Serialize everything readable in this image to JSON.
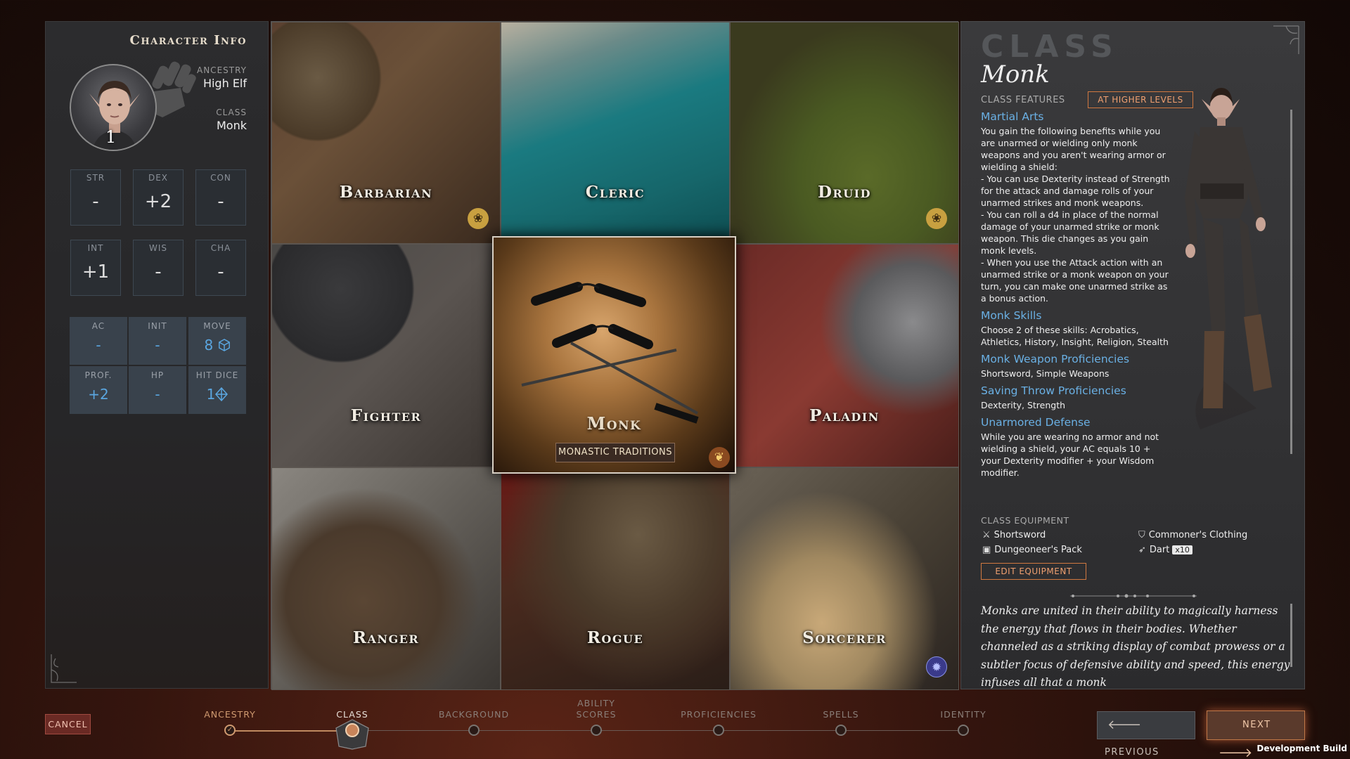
{
  "left_panel": {
    "title": "Character Info",
    "level": "1",
    "ancestry_label": "ANCESTRY",
    "ancestry_value": "High Elf",
    "class_label": "CLASS",
    "class_value": "Monk",
    "abilities": [
      {
        "label": "STR",
        "value": "-"
      },
      {
        "label": "DEX",
        "value": "+2"
      },
      {
        "label": "CON",
        "value": "-"
      },
      {
        "label": "INT",
        "value": "+1"
      },
      {
        "label": "WIS",
        "value": "-"
      },
      {
        "label": "CHA",
        "value": "-"
      }
    ],
    "combat": [
      {
        "label": "AC",
        "value": "-"
      },
      {
        "label": "INIT",
        "value": "-"
      },
      {
        "label": "MOVE",
        "value": "8",
        "icon": "cube-icon"
      },
      {
        "label": "PROF.",
        "value": "+2"
      },
      {
        "label": "HP",
        "value": "-"
      },
      {
        "label": "HIT DICE",
        "value": "1",
        "icon": "d8-icon"
      }
    ]
  },
  "classes": [
    {
      "name": "Barbarian",
      "badge": "paw-icon"
    },
    {
      "name": "Cleric"
    },
    {
      "name": "Druid",
      "badge": "paw-icon"
    },
    {
      "name": "Fighter"
    },
    {
      "name": "Monk",
      "subclass_button": "MONASTIC TRADITIONS",
      "badge": "cornucopia-icon",
      "selected": true
    },
    {
      "name": "Paladin"
    },
    {
      "name": "Ranger"
    },
    {
      "name": "Rogue"
    },
    {
      "name": "Sorcerer",
      "badge": "magic-swirl-icon"
    }
  ],
  "right_panel": {
    "heading": "CLASS",
    "class_name": "Monk",
    "features_label": "CLASS FEATURES",
    "higher_levels_button": "AT HIGHER LEVELS",
    "features": [
      {
        "title": "Martial Arts",
        "text": "You gain the following benefits while you are unarmed or wielding only monk weapons and you aren't wearing armor or wielding a shield:\n - You can use Dexterity instead of Strength for the attack and damage rolls of your unarmed strikes and monk weapons.\n - You can roll a d4 in place of the normal damage of your unarmed strike or monk weapon. This die changes as you gain monk levels.\n - When you use the Attack action with an unarmed strike or a monk weapon on your turn, you can make one unarmed strike as a bonus action."
      },
      {
        "title": "Monk Skills",
        "text": "Choose 2 of these skills: Acrobatics, Athletics, History, Insight, Religion, Stealth"
      },
      {
        "title": "Monk Weapon Proficiencies",
        "text": "Shortsword, Simple Weapons"
      },
      {
        "title": "Saving Throw Proficiencies",
        "text": "Dexterity, Strength"
      },
      {
        "title": "Unarmored Defense",
        "text": "While you are wearing no armor and not wielding a shield, your AC equals 10 + your Dexterity modifier + your Wisdom modifier."
      }
    ],
    "equipment_label": "CLASS EQUIPMENT",
    "equipment": [
      {
        "name": "Shortsword",
        "icon": "sword-icon"
      },
      {
        "name": "Commoner's Clothing",
        "icon": "shield-icon"
      },
      {
        "name": "Dungeoneer's Pack",
        "icon": "backpack-icon"
      },
      {
        "name": "Dart",
        "icon": "dart-icon",
        "quantity": "x10"
      }
    ],
    "edit_equipment_button": "EDIT EQUIPMENT",
    "description": "Monks are united in their ability to magically harness the energy that flows in their bodies. Whether channeled as a striking display of combat prowess or a subtler focus of defensive ability and speed, this energy infuses all that a monk"
  },
  "footer": {
    "cancel": "CANCEL",
    "steps": [
      {
        "label": "ANCESTRY",
        "state": "done"
      },
      {
        "label": "CLASS",
        "state": "current"
      },
      {
        "label": "BACKGROUND",
        "state": "pending"
      },
      {
        "label": "ABILITY\nSCORES",
        "state": "pending"
      },
      {
        "label": "PROFICIENCIES",
        "state": "pending"
      },
      {
        "label": "SPELLS",
        "state": "pending"
      },
      {
        "label": "IDENTITY",
        "state": "pending"
      }
    ],
    "previous": "PREVIOUS",
    "next": "NEXT",
    "build_label": "Development Build"
  },
  "colors": {
    "accent_orange": "#d07840",
    "link_blue": "#6ab0e4",
    "cancel_red": "#6a2a24"
  }
}
